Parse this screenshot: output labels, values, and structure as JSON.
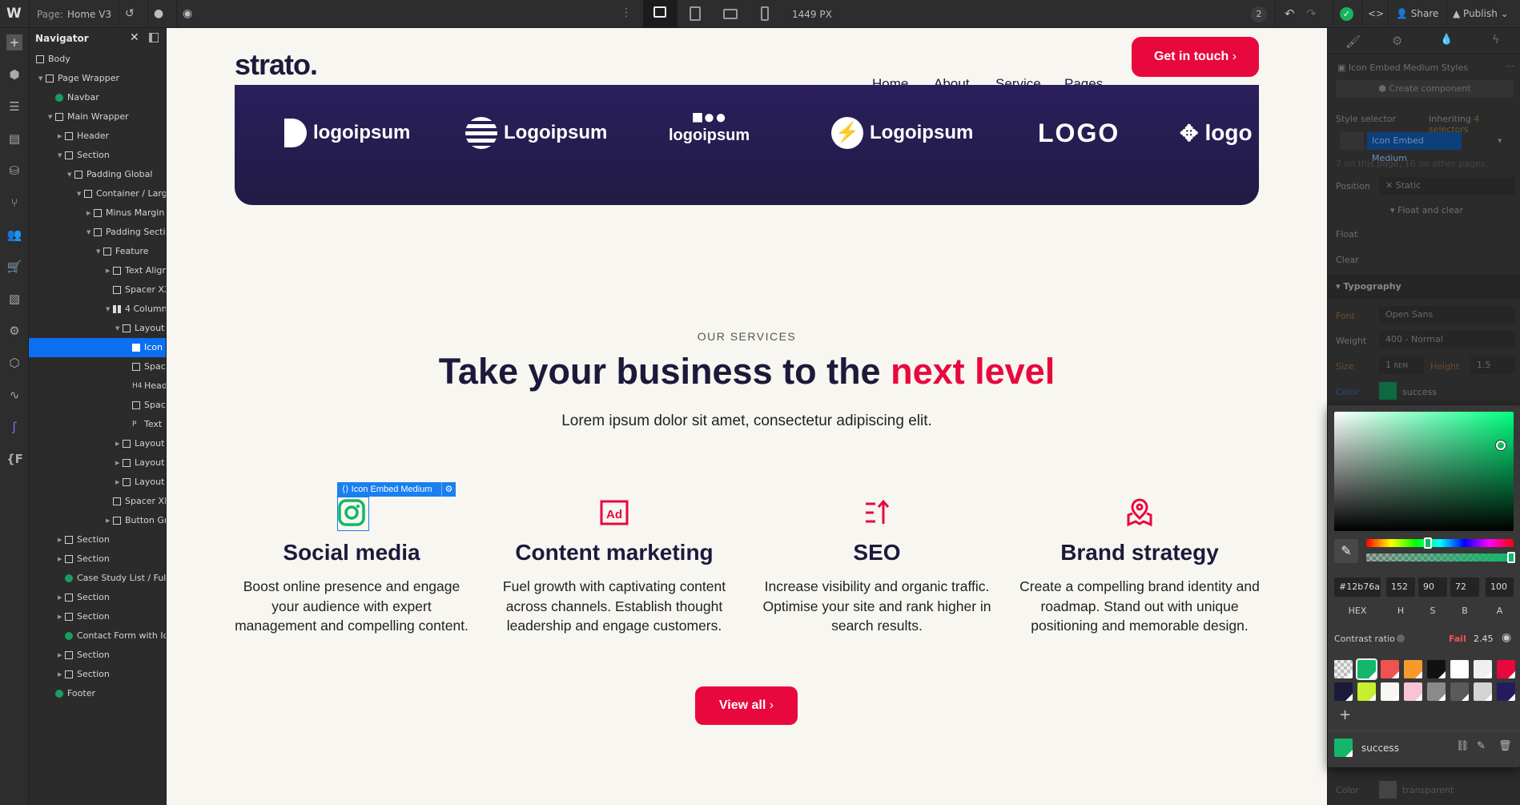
{
  "topbar": {
    "logo": "W",
    "page_label": "Page:",
    "page_name": "Home V3",
    "width": "1449 PX",
    "notifications": "2",
    "share": "Share",
    "publish": "Publish"
  },
  "navigator": {
    "title": "Navigator",
    "items": [
      {
        "label": "Body",
        "level": 0,
        "caret": false,
        "icon": "body"
      },
      {
        "label": "Page Wrapper",
        "level": 1,
        "caret": "open",
        "icon": "box"
      },
      {
        "label": "Navbar",
        "level": 2,
        "caret": false,
        "icon": "component"
      },
      {
        "label": "Main Wrapper",
        "level": 2,
        "caret": "open",
        "icon": "box"
      },
      {
        "label": "Header",
        "level": 3,
        "caret": "closed",
        "icon": "box"
      },
      {
        "label": "Section",
        "level": 3,
        "caret": "open",
        "icon": "box"
      },
      {
        "label": "Padding Global",
        "level": 4,
        "caret": "open",
        "icon": "box"
      },
      {
        "label": "Container / Large",
        "level": 5,
        "caret": "open",
        "icon": "box"
      },
      {
        "label": "Minus Margin /",
        "level": 6,
        "caret": "closed",
        "icon": "box"
      },
      {
        "label": "Padding Section",
        "level": 6,
        "caret": "open",
        "icon": "box"
      },
      {
        "label": "Feature",
        "level": 7,
        "caret": "open",
        "icon": "box"
      },
      {
        "label": "Text Align",
        "level": 8,
        "caret": "closed",
        "icon": "box"
      },
      {
        "label": "Spacer XX",
        "level": 8,
        "caret": false,
        "icon": "box"
      },
      {
        "label": "4 Column",
        "level": 8,
        "caret": "open",
        "icon": "grid"
      },
      {
        "label": "Layout",
        "level": 9,
        "caret": "open",
        "icon": "box"
      },
      {
        "label": "Icon Embed",
        "level": 10,
        "caret": false,
        "icon": "embed",
        "selected": true
      },
      {
        "label": "Spacer",
        "level": 10,
        "caret": false,
        "icon": "box"
      },
      {
        "label": "Heading",
        "level": 10,
        "caret": false,
        "icon": "H4"
      },
      {
        "label": "Spacer",
        "level": 10,
        "caret": false,
        "icon": "box"
      },
      {
        "label": "Text",
        "level": 10,
        "caret": false,
        "icon": "P"
      },
      {
        "label": "Layout",
        "level": 9,
        "caret": "closed",
        "icon": "box"
      },
      {
        "label": "Layout",
        "level": 9,
        "caret": "closed",
        "icon": "box"
      },
      {
        "label": "Layout",
        "level": 9,
        "caret": "closed",
        "icon": "box"
      },
      {
        "label": "Spacer XL",
        "level": 8,
        "caret": false,
        "icon": "box"
      },
      {
        "label": "Button Group",
        "level": 8,
        "caret": "closed",
        "icon": "box"
      },
      {
        "label": "Section",
        "level": 3,
        "caret": "closed",
        "icon": "box"
      },
      {
        "label": "Section",
        "level": 3,
        "caret": "closed",
        "icon": "box"
      },
      {
        "label": "Case Study List / Full",
        "level": 3,
        "caret": false,
        "icon": "component"
      },
      {
        "label": "Section",
        "level": 3,
        "caret": "closed",
        "icon": "box"
      },
      {
        "label": "Section",
        "level": 3,
        "caret": "closed",
        "icon": "box"
      },
      {
        "label": "Contact Form with Icon",
        "level": 3,
        "caret": false,
        "icon": "component"
      },
      {
        "label": "Section",
        "level": 3,
        "caret": "closed",
        "icon": "box"
      },
      {
        "label": "Section",
        "level": 3,
        "caret": "closed",
        "icon": "box"
      },
      {
        "label": "Footer",
        "level": 2,
        "caret": false,
        "icon": "component"
      }
    ]
  },
  "site": {
    "brand": "strato.",
    "nav": [
      "Home",
      "About",
      "Service",
      "Pages"
    ],
    "cta": "Get in touch",
    "logos": [
      "logoipsum",
      "Logoipsum",
      "logoipsum",
      "Logoipsum",
      "LOGO",
      "logo"
    ],
    "eyebrow": "OUR SERVICES",
    "heading_main": "Take your business to the ",
    "heading_accent": "next level",
    "subtext": "Lorem ipsum dolor sit amet, consectetur adipiscing elit.",
    "selected_label": "Icon Embed Medium",
    "services": [
      {
        "title": "Social media",
        "desc": "Boost online presence and engage your audience with expert management and compelling content.",
        "icon": "instagram-icon"
      },
      {
        "title": "Content marketing",
        "desc": "Fuel growth with captivating content across channels. Establish thought leadership and engage customers.",
        "icon": "ad-icon"
      },
      {
        "title": "SEO",
        "desc": "Increase visibility and organic traffic. Optimise your site and rank higher in search results.",
        "icon": "sort-up-icon"
      },
      {
        "title": "Brand strategy",
        "desc": "Create a compelling brand identity and roadmap. Stand out with unique positioning and memorable design.",
        "icon": "map-pin-icon"
      }
    ],
    "view_all": "View all",
    "colors": {
      "accent": "#e8083e",
      "navy": "#241c4d",
      "text": "#1c1a3b",
      "success": "#12b76a"
    }
  },
  "style_panel": {
    "styles_title": "Icon Embed Medium Styles",
    "create_component": "Create component",
    "style_selector": "Style selector",
    "inheriting": "Inheriting",
    "inheriting_count": "4 selectors",
    "selector": "Icon Embed Medium",
    "usage": "7 on this page, 16 on other pages.",
    "position_label": "Position",
    "position_value": "Static",
    "float_and_clear": "Float and clear",
    "float_label": "Float",
    "clear_label": "Clear",
    "typography": "Typography",
    "font_label": "Font",
    "font_value": "Open Sans",
    "weight_label": "Weight",
    "weight_value": "400 - Normal",
    "size_label": "Size",
    "size_value": "1",
    "size_unit": "REM",
    "height_label": "Height",
    "height_value": "1.5",
    "color_label": "Color",
    "color_value": "success",
    "bg_color_label": "Color",
    "bg_color_value": "transparent"
  },
  "picker": {
    "hex": "#12b76a",
    "h": "152",
    "s": "90",
    "b": "72",
    "a": "100",
    "labels": [
      "HEX",
      "H",
      "S",
      "B",
      "A"
    ],
    "contrast_label": "Contrast ratio",
    "contrast_status": "Fail",
    "contrast_value": "2.45",
    "swatches": [
      "transparent",
      "#12b76a",
      "#f05252",
      "#f79a2b",
      "#111111",
      "#ffffff",
      "#efefef",
      "#e8083e",
      "#1c1a3b",
      "#c4f031",
      "#f7f6f0",
      "#f8c4d4",
      "#8a8a8a",
      "#5a5a5a",
      "#d4d4d4",
      "#241c5e"
    ],
    "selected_swatch_name": "success",
    "hue_fraction": 0.42,
    "alpha_percent": 100
  }
}
